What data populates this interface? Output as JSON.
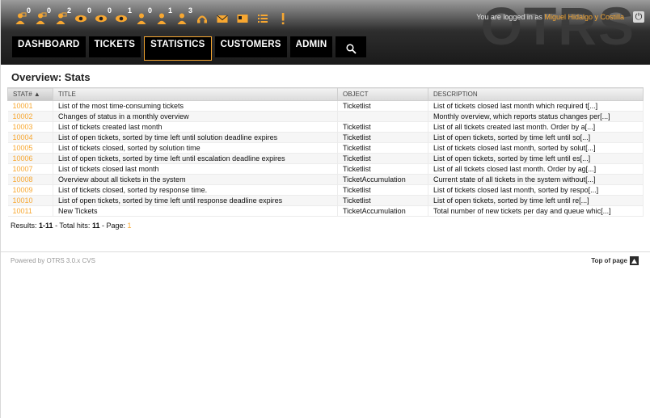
{
  "header": {
    "logo": "OTRS",
    "login_prefix": "You are logged in as",
    "user_name": "Miguel Hidalgo y Costilla",
    "logout_glyph": "⏻"
  },
  "toolbar": {
    "items": [
      {
        "icon": "locked-tickets-icon",
        "count": "0"
      },
      {
        "icon": "new-locked-tickets-icon",
        "count": "0"
      },
      {
        "icon": "reminder-locked-tickets-icon",
        "count": "2"
      },
      {
        "icon": "watched-tickets-icon",
        "count": "0"
      },
      {
        "icon": "new-watched-tickets-icon",
        "count": "0"
      },
      {
        "icon": "reminder-watched-tickets-icon",
        "count": "1"
      },
      {
        "icon": "responsible-tickets-icon",
        "count": "0"
      },
      {
        "icon": "new-responsible-tickets-icon",
        "count": "1"
      },
      {
        "icon": "reminder-responsible-tickets-icon",
        "count": "3"
      },
      {
        "icon": "new-phone-ticket-icon",
        "count": ""
      },
      {
        "icon": "new-email-ticket-icon",
        "count": ""
      },
      {
        "icon": "customer-icon",
        "count": ""
      },
      {
        "icon": "queue-view-icon",
        "count": ""
      },
      {
        "icon": "escalation-icon",
        "count": ""
      }
    ]
  },
  "nav": {
    "items": [
      "DASHBOARD",
      "TICKETS",
      "STATISTICS",
      "CUSTOMERS",
      "ADMIN"
    ],
    "selected": "STATISTICS"
  },
  "main": {
    "title": "Overview: Stats",
    "columns": [
      "STAT# ▲",
      "TITLE",
      "OBJECT",
      "DESCRIPTION"
    ],
    "rows": [
      {
        "stat": "10001",
        "title": "List of the most time-consuming tickets",
        "object": "Ticketlist",
        "description": "List of tickets closed last month which required t[...]"
      },
      {
        "stat": "10002",
        "title": "Changes of status in a monthly overview",
        "object": "",
        "description": "Monthly overview, which reports status changes per[...]"
      },
      {
        "stat": "10003",
        "title": "List of tickets created last month",
        "object": "Ticketlist",
        "description": "List of all tickets created last month. Order by a[...]"
      },
      {
        "stat": "10004",
        "title": "List of open tickets, sorted by time left until solution deadline expires",
        "object": "Ticketlist",
        "description": "List of open tickets, sorted by time left until so[...]"
      },
      {
        "stat": "10005",
        "title": "List of tickets closed, sorted by solution time",
        "object": "Ticketlist",
        "description": "List of tickets closed last month, sorted by solut[...]"
      },
      {
        "stat": "10006",
        "title": "List of open tickets, sorted by time left until escalation deadline expires",
        "object": "Ticketlist",
        "description": "List of open tickets, sorted by time left until es[...]"
      },
      {
        "stat": "10007",
        "title": "List of tickets closed last month",
        "object": "Ticketlist",
        "description": "List of all tickets closed last month. Order by ag[...]"
      },
      {
        "stat": "10008",
        "title": "Overview about all tickets in the system",
        "object": "TicketAccumulation",
        "description": "Current state of all tickets in the system without[...]"
      },
      {
        "stat": "10009",
        "title": "List of tickets closed, sorted by response time.",
        "object": "Ticketlist",
        "description": "List of tickets closed last month, sorted by respo[...]"
      },
      {
        "stat": "10010",
        "title": "List of open tickets, sorted by time left until response deadline expires",
        "object": "Ticketlist",
        "description": "List of open tickets, sorted by time left until re[...]"
      },
      {
        "stat": "10011",
        "title": "New Tickets",
        "object": "TicketAccumulation",
        "description": "Total number of new tickets per day and queue whic[...]"
      }
    ],
    "results": {
      "label": "Results:",
      "range": "1-11",
      "total_label": "- Total hits:",
      "total": "11",
      "page_label": "- Page:",
      "page": "1"
    }
  },
  "footer": {
    "powered_by": "Powered by OTRS 3.0.x CVS",
    "top_of_page": "Top of page"
  },
  "colors": {
    "accent": "#f7a731",
    "header_dark": "#1a1a1a"
  }
}
